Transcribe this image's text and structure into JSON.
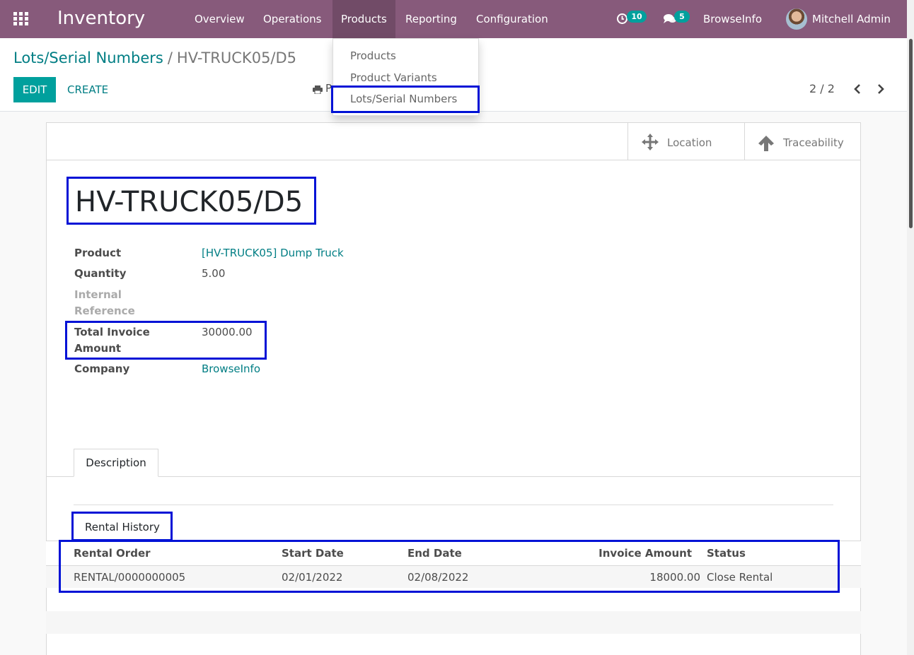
{
  "navbar": {
    "brand": "Inventory",
    "menu": [
      "Overview",
      "Operations",
      "Products",
      "Reporting",
      "Configuration"
    ],
    "activities_count": "10",
    "messages_count": "5",
    "company": "BrowseInfo",
    "user": "Mitchell Admin"
  },
  "products_menu": {
    "items": [
      "Products",
      "Product Variants",
      "Lots/Serial Numbers"
    ]
  },
  "control_panel": {
    "breadcrumb_parent": "Lots/Serial Numbers",
    "breadcrumb_separator": "/",
    "breadcrumb_current": "HV-TRUCK05/D5",
    "edit_label": "EDIT",
    "create_label": "CREATE",
    "print_label_partial": "P",
    "pager": "2 / 2"
  },
  "smart_buttons": {
    "location": "Location",
    "traceability": "Traceability"
  },
  "record": {
    "name": "HV-TRUCK05/D5",
    "fields": {
      "product_label": "Product",
      "product_value": "[HV-TRUCK05] Dump Truck",
      "quantity_label": "Quantity",
      "quantity_value": "5.00",
      "internal_ref_label_1": "Internal",
      "internal_ref_label_2": "Reference",
      "total_invoice_label_1": "Total Invoice",
      "total_invoice_label_2": "Amount",
      "total_invoice_value": "30000.00",
      "company_label": "Company",
      "company_value": "BrowseInfo"
    }
  },
  "notebook": {
    "tab_description": "Description"
  },
  "rental_history": {
    "title": "Rental History",
    "columns": [
      "Rental Order",
      "Start Date",
      "End Date",
      "Invoice Amount",
      "Status"
    ],
    "rows": [
      [
        "RENTAL/0000000005",
        "02/01/2022",
        "02/08/2022",
        "18000.00",
        "Close Rental"
      ]
    ]
  },
  "colors": {
    "navbar": "#875a7b",
    "accent": "#00a09d",
    "link": "#017e84",
    "highlight": "#0012d6"
  }
}
